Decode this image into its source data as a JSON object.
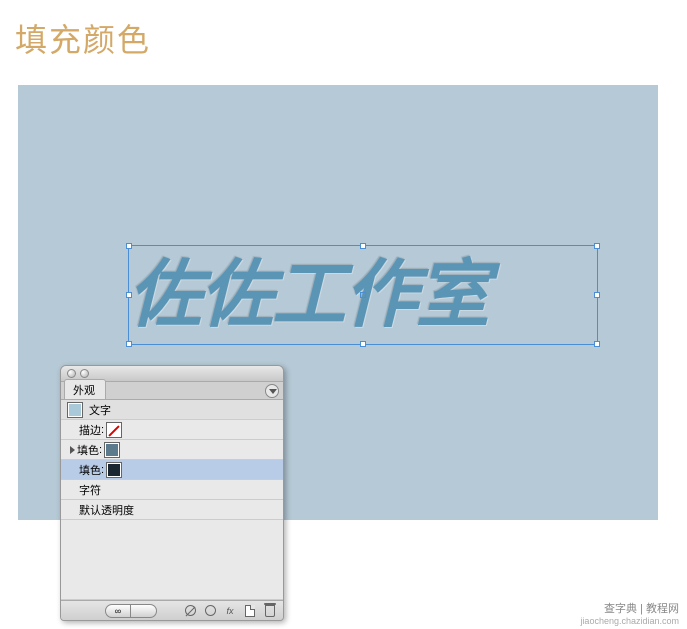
{
  "title": "填充颜色",
  "canvas": {
    "text": "佐佐工作室"
  },
  "panel": {
    "tab": "外观",
    "rows": {
      "object_type": "文字",
      "stroke_label": "描边",
      "fill1_label": "填色",
      "fill2_label": "填色",
      "char_label": "字符",
      "opacity_label": "默认透明度"
    },
    "swatches": {
      "object_color": "#a9c9d9",
      "fill1_color": "#5b7a8c",
      "fill2_color": "#1a2733"
    },
    "footer_pill": "∞"
  },
  "watermark": {
    "line1": "查字典 | 教程网",
    "line2": "jiaocheng.chazidian.com"
  }
}
